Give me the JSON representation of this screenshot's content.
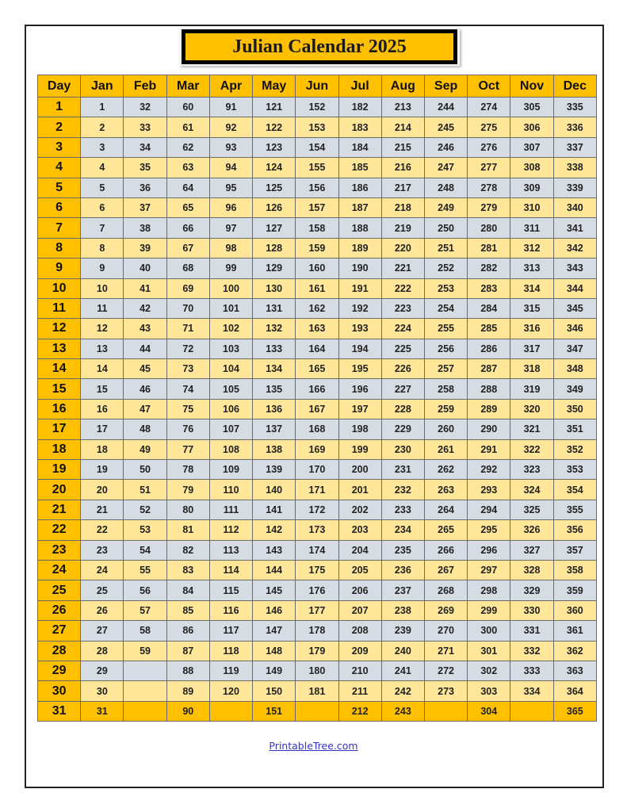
{
  "title": "Julian Calendar 2025",
  "colors": {
    "header": "#ffc000",
    "row_odd": "#d6dce4",
    "row_even": "#ffe699",
    "last_row": "#ffc000",
    "link": "#3333cc"
  },
  "table": {
    "headers": [
      "Day",
      "Jan",
      "Feb",
      "Mar",
      "Apr",
      "May",
      "Jun",
      "Jul",
      "Aug",
      "Sep",
      "Oct",
      "Nov",
      "Dec"
    ],
    "rows": [
      [
        "1",
        "1",
        "32",
        "60",
        "91",
        "121",
        "152",
        "182",
        "213",
        "244",
        "274",
        "305",
        "335"
      ],
      [
        "2",
        "2",
        "33",
        "61",
        "92",
        "122",
        "153",
        "183",
        "214",
        "245",
        "275",
        "306",
        "336"
      ],
      [
        "3",
        "3",
        "34",
        "62",
        "93",
        "123",
        "154",
        "184",
        "215",
        "246",
        "276",
        "307",
        "337"
      ],
      [
        "4",
        "4",
        "35",
        "63",
        "94",
        "124",
        "155",
        "185",
        "216",
        "247",
        "277",
        "308",
        "338"
      ],
      [
        "5",
        "5",
        "36",
        "64",
        "95",
        "125",
        "156",
        "186",
        "217",
        "248",
        "278",
        "309",
        "339"
      ],
      [
        "6",
        "6",
        "37",
        "65",
        "96",
        "126",
        "157",
        "187",
        "218",
        "249",
        "279",
        "310",
        "340"
      ],
      [
        "7",
        "7",
        "38",
        "66",
        "97",
        "127",
        "158",
        "188",
        "219",
        "250",
        "280",
        "311",
        "341"
      ],
      [
        "8",
        "8",
        "39",
        "67",
        "98",
        "128",
        "159",
        "189",
        "220",
        "251",
        "281",
        "312",
        "342"
      ],
      [
        "9",
        "9",
        "40",
        "68",
        "99",
        "129",
        "160",
        "190",
        "221",
        "252",
        "282",
        "313",
        "343"
      ],
      [
        "10",
        "10",
        "41",
        "69",
        "100",
        "130",
        "161",
        "191",
        "222",
        "253",
        "283",
        "314",
        "344"
      ],
      [
        "11",
        "11",
        "42",
        "70",
        "101",
        "131",
        "162",
        "192",
        "223",
        "254",
        "284",
        "315",
        "345"
      ],
      [
        "12",
        "12",
        "43",
        "71",
        "102",
        "132",
        "163",
        "193",
        "224",
        "255",
        "285",
        "316",
        "346"
      ],
      [
        "13",
        "13",
        "44",
        "72",
        "103",
        "133",
        "164",
        "194",
        "225",
        "256",
        "286",
        "317",
        "347"
      ],
      [
        "14",
        "14",
        "45",
        "73",
        "104",
        "134",
        "165",
        "195",
        "226",
        "257",
        "287",
        "318",
        "348"
      ],
      [
        "15",
        "15",
        "46",
        "74",
        "105",
        "135",
        "166",
        "196",
        "227",
        "258",
        "288",
        "319",
        "349"
      ],
      [
        "16",
        "16",
        "47",
        "75",
        "106",
        "136",
        "167",
        "197",
        "228",
        "259",
        "289",
        "320",
        "350"
      ],
      [
        "17",
        "17",
        "48",
        "76",
        "107",
        "137",
        "168",
        "198",
        "229",
        "260",
        "290",
        "321",
        "351"
      ],
      [
        "18",
        "18",
        "49",
        "77",
        "108",
        "138",
        "169",
        "199",
        "230",
        "261",
        "291",
        "322",
        "352"
      ],
      [
        "19",
        "19",
        "50",
        "78",
        "109",
        "139",
        "170",
        "200",
        "231",
        "262",
        "292",
        "323",
        "353"
      ],
      [
        "20",
        "20",
        "51",
        "79",
        "110",
        "140",
        "171",
        "201",
        "232",
        "263",
        "293",
        "324",
        "354"
      ],
      [
        "21",
        "21",
        "52",
        "80",
        "111",
        "141",
        "172",
        "202",
        "233",
        "264",
        "294",
        "325",
        "355"
      ],
      [
        "22",
        "22",
        "53",
        "81",
        "112",
        "142",
        "173",
        "203",
        "234",
        "265",
        "295",
        "326",
        "356"
      ],
      [
        "23",
        "23",
        "54",
        "82",
        "113",
        "143",
        "174",
        "204",
        "235",
        "266",
        "296",
        "327",
        "357"
      ],
      [
        "24",
        "24",
        "55",
        "83",
        "114",
        "144",
        "175",
        "205",
        "236",
        "267",
        "297",
        "328",
        "358"
      ],
      [
        "25",
        "25",
        "56",
        "84",
        "115",
        "145",
        "176",
        "206",
        "237",
        "268",
        "298",
        "329",
        "359"
      ],
      [
        "26",
        "26",
        "57",
        "85",
        "116",
        "146",
        "177",
        "207",
        "238",
        "269",
        "299",
        "330",
        "360"
      ],
      [
        "27",
        "27",
        "58",
        "86",
        "117",
        "147",
        "178",
        "208",
        "239",
        "270",
        "300",
        "331",
        "361"
      ],
      [
        "28",
        "28",
        "59",
        "87",
        "118",
        "148",
        "179",
        "209",
        "240",
        "271",
        "301",
        "332",
        "362"
      ],
      [
        "29",
        "29",
        "",
        "88",
        "119",
        "149",
        "180",
        "210",
        "241",
        "272",
        "302",
        "333",
        "363"
      ],
      [
        "30",
        "30",
        "",
        "89",
        "120",
        "150",
        "181",
        "211",
        "242",
        "273",
        "303",
        "334",
        "364"
      ],
      [
        "31",
        "31",
        "",
        "90",
        "",
        "151",
        "",
        "212",
        "243",
        "",
        "304",
        "",
        "365"
      ]
    ]
  },
  "footer": {
    "link_text": "PrintableTree.com"
  }
}
